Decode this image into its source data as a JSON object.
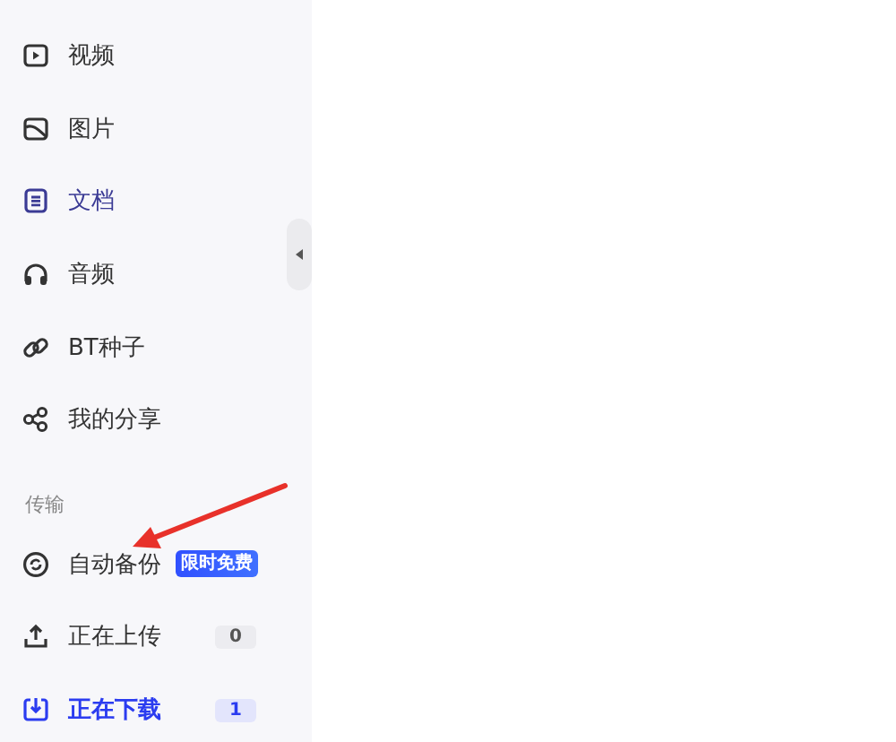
{
  "sidebar": {
    "items": [
      {
        "kind": "video",
        "label": "视频",
        "selected": false,
        "hovered": false
      },
      {
        "kind": "image",
        "label": "图片",
        "selected": false,
        "hovered": false
      },
      {
        "kind": "document",
        "label": "文档",
        "selected": false,
        "hovered": true
      },
      {
        "kind": "audio",
        "label": "音频",
        "selected": false,
        "hovered": false
      },
      {
        "kind": "link",
        "label": "BT种子",
        "selected": false,
        "hovered": false
      },
      {
        "kind": "share",
        "label": "我的分享",
        "selected": false,
        "hovered": false
      }
    ],
    "transfer_section": {
      "title": "传输",
      "items": [
        {
          "kind": "sync",
          "label": "自动备份",
          "tag": "限时免费",
          "selected": false
        },
        {
          "kind": "upload",
          "label": "正在上传",
          "count": "0",
          "selected": false
        },
        {
          "kind": "download",
          "label": "正在下载",
          "count": "1",
          "selected": true
        }
      ]
    }
  },
  "annotation": {
    "kind": "arrow"
  }
}
